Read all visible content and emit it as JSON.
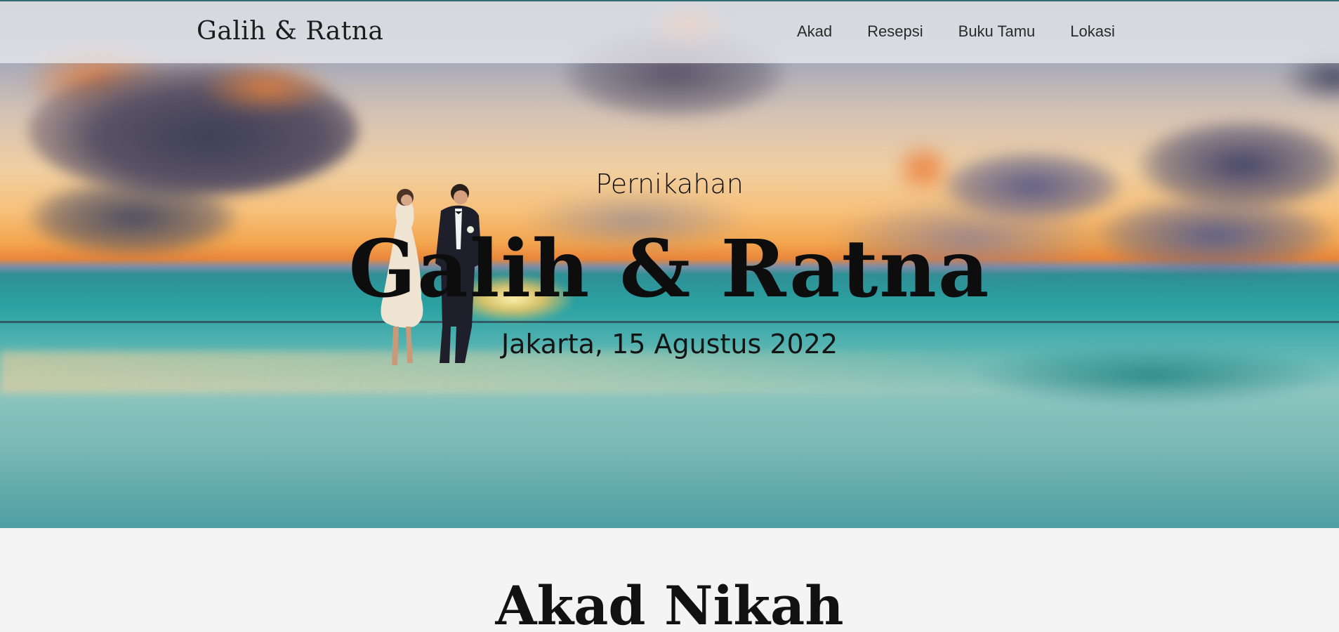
{
  "navbar": {
    "brand": "Galih & Ratna",
    "links": [
      {
        "label": "Akad"
      },
      {
        "label": "Resepsi"
      },
      {
        "label": "Buku Tamu"
      },
      {
        "label": "Lokasi"
      }
    ]
  },
  "hero": {
    "kicker": "Pernikahan",
    "title": "Galih & Ratna",
    "subtitle": "Jakarta, 15 Agustus 2022"
  },
  "akad": {
    "title": "Akad Nikah"
  },
  "colors": {
    "navbar_bg": "#eeeef0",
    "navbar_border": "#2f6f73",
    "text": "#111111",
    "page_bg": "#f4f4f4"
  }
}
